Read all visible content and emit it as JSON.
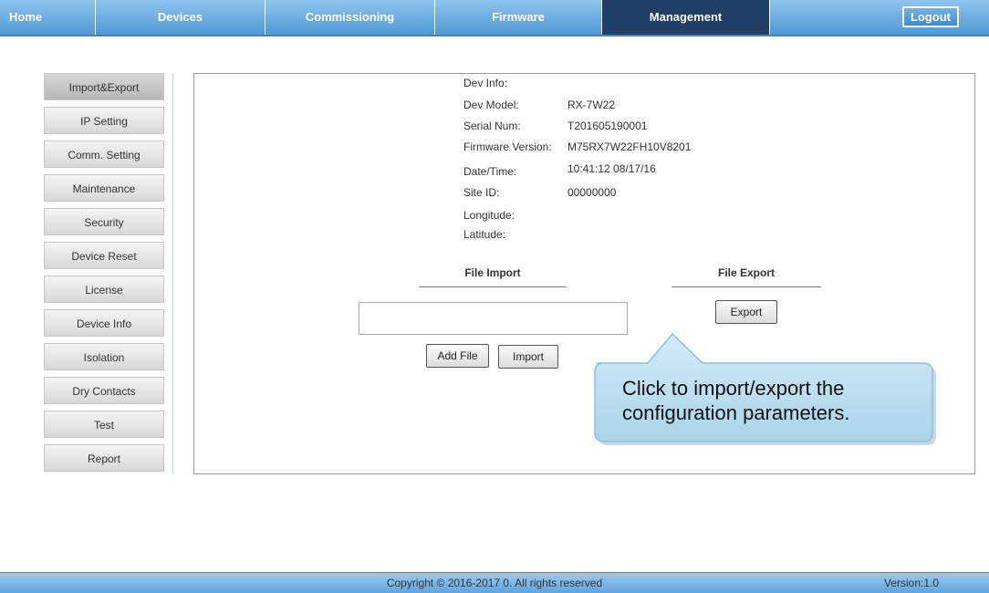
{
  "nav": {
    "tabs": [
      "Home",
      "Devices",
      "Commissioning",
      "Firmware",
      "Management"
    ],
    "active": "Management",
    "logout_label": "Logout"
  },
  "sidebar": {
    "items": [
      "Import&Export",
      "IP Setting",
      "Comm. Setting",
      "Maintenance",
      "Security",
      "Device Reset",
      "License",
      "Device Info",
      "Isolation",
      "Dry Contacts",
      "Test",
      "Report"
    ],
    "active": "Import&Export"
  },
  "dev_info": {
    "header": "Dev Info:",
    "rows": [
      {
        "label": "Dev Model:",
        "value": "RX-7W22"
      },
      {
        "label": "Serial Num:",
        "value": "T201605190001"
      },
      {
        "label": "Firmware Version:",
        "value": "M75RX7W22FH10V8201"
      },
      {
        "label": "Date/Time:",
        "value": "10:41:12 08/17/16"
      },
      {
        "label": "Site ID:",
        "value": "00000000"
      },
      {
        "label": "Longitude:",
        "value": ""
      },
      {
        "label": "Latitude:",
        "value": ""
      }
    ]
  },
  "file_import": {
    "title": "File Import",
    "file_value": "",
    "add_file_label": "Add File",
    "import_label": "Import"
  },
  "file_export": {
    "title": "File Export",
    "export_label": "Export"
  },
  "callout": {
    "line1": "Click to import/export the",
    "line2": "configuration parameters."
  },
  "footer": {
    "copyright": "Copyright © 2016-2017 0. All rights reserved",
    "version": "Version:1.0"
  },
  "colors": {
    "nav_gradient_top": "#8ec4ee",
    "nav_gradient_bottom": "#4f98d6",
    "nav_active": "#1f3f66",
    "callout_fill": "#b9dcef",
    "callout_border": "#8cc0dd"
  }
}
